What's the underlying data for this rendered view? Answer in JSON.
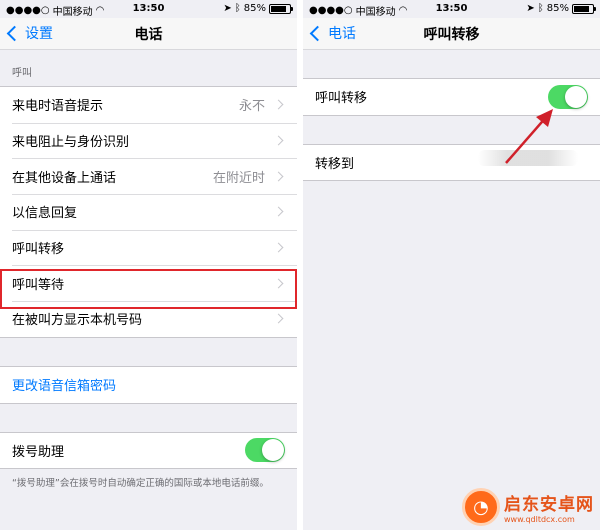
{
  "status_bar": {
    "carrier": "中国移动",
    "time": "13:50",
    "battery": "85%",
    "battery_level": 0.85
  },
  "left": {
    "back_label": "设置",
    "title": "电话",
    "section_header": "呼叫",
    "rows": [
      {
        "label": "来电时语音提示",
        "value": "永不"
      },
      {
        "label": "来电阻止与身份识别",
        "value": ""
      },
      {
        "label": "在其他设备上通话",
        "value": "在附近时"
      },
      {
        "label": "以信息回复",
        "value": ""
      },
      {
        "label": "呼叫转移",
        "value": ""
      },
      {
        "label": "呼叫等待",
        "value": ""
      },
      {
        "label": "在被叫方显示本机号码",
        "value": ""
      }
    ],
    "voicemail_link": "更改语音信箱密码",
    "dial_assist_label": "拨号助理",
    "dial_assist_on": true,
    "footnote": "“拨号助理”会在拨号时自动确定正确的国际或本地电话前缀。"
  },
  "right": {
    "back_label": "电话",
    "title": "呼叫转移",
    "forward_toggle_label": "呼叫转移",
    "forward_on": true,
    "forward_to_label": "转移到"
  },
  "colors": {
    "accent": "#007aff",
    "toggle_on": "#4cd964",
    "highlight": "#e0262b"
  },
  "watermark": {
    "name": "启东安卓网",
    "url": "www.qdltdcx.com"
  }
}
